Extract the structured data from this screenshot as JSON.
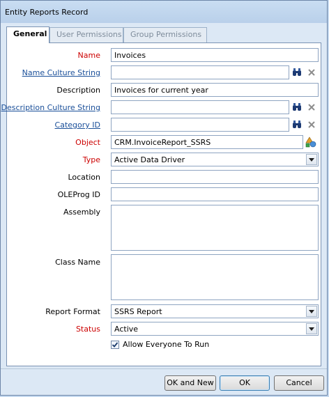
{
  "window": {
    "title": "Entity Reports Record"
  },
  "tabs": [
    {
      "label": "General"
    },
    {
      "label": "User Permissions"
    },
    {
      "label": "Group Permissions"
    }
  ],
  "fields": {
    "name": {
      "label": "Name",
      "value": "Invoices"
    },
    "name_culture": {
      "label": "Name Culture String",
      "value": ""
    },
    "description": {
      "label": "Description",
      "value": "Invoices for current year"
    },
    "description_culture": {
      "label": "Description Culture String",
      "value": ""
    },
    "category": {
      "label": "Category ID",
      "value": ""
    },
    "object": {
      "label": "Object",
      "value": "CRM.InvoiceReport_SSRS"
    },
    "type": {
      "label": "Type",
      "value": "Active Data Driver"
    },
    "location": {
      "label": "Location",
      "value": ""
    },
    "oleprog": {
      "label": "OLEProg ID",
      "value": ""
    },
    "assembly": {
      "label": "Assembly",
      "value": ""
    },
    "classname": {
      "label": "Class Name",
      "value": ""
    },
    "report_format": {
      "label": "Report Format",
      "value": "SSRS Report"
    },
    "status": {
      "label": "Status",
      "value": "Active"
    },
    "allow_everyone": {
      "label": "Allow Everyone To Run",
      "checked": true
    }
  },
  "buttons": {
    "ok_new": "OK and New",
    "ok": "OK",
    "cancel": "Cancel"
  },
  "icons": {
    "lookup": "binoculars-icon",
    "clear": "clear-x-icon",
    "object_lookup": "object-shapes-icon",
    "dropdown": "chevron-down-icon",
    "check": "checkmark-icon"
  }
}
